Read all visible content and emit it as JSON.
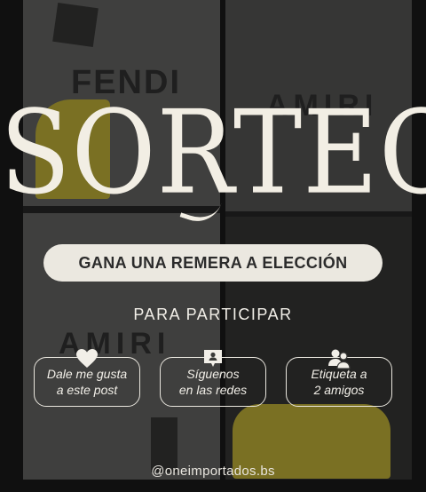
{
  "background_print": {
    "brand_top_left": "FENDI",
    "brand_top_right": "AMIRI",
    "brand_mid_left": "AMIRI"
  },
  "title": "SORTEO",
  "prize_banner": "GANA UNA REMERA A ELECCIÓN",
  "subhead": "PARA PARTICIPAR",
  "steps": [
    {
      "line1": "Dale me gusta",
      "line2": "a este post",
      "icon": "heart-icon"
    },
    {
      "line1": "Síguenos",
      "line2": "en las redes",
      "icon": "chat-profile-icon"
    },
    {
      "line1": "Etiqueta a",
      "line2": "2 amigos",
      "icon": "two-users-icon"
    }
  ],
  "handle": "@oneimportados.bs",
  "colors": {
    "text": "#f2efe8",
    "banner_bg": "#ebe8e0",
    "banner_text": "#2b2b2b",
    "accent_yellow": "#b9a92c"
  }
}
